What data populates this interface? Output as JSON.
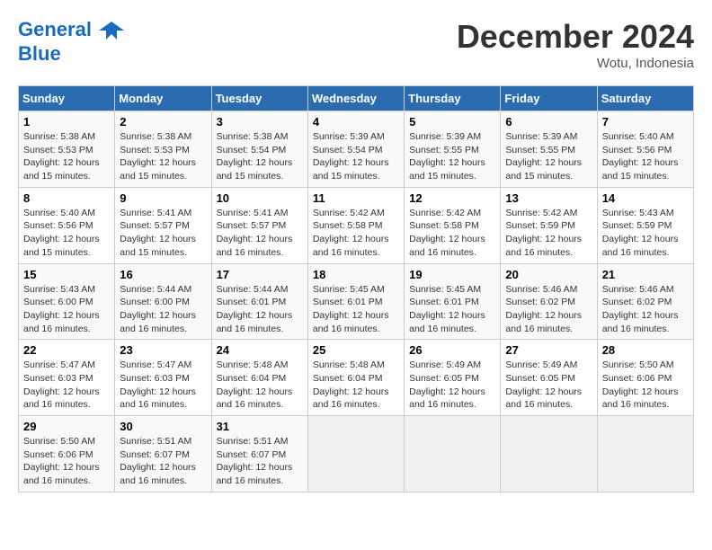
{
  "header": {
    "logo_line1": "General",
    "logo_line2": "Blue",
    "month": "December 2024",
    "location": "Wotu, Indonesia"
  },
  "days_of_week": [
    "Sunday",
    "Monday",
    "Tuesday",
    "Wednesday",
    "Thursday",
    "Friday",
    "Saturday"
  ],
  "weeks": [
    [
      {
        "day": "1",
        "sunrise": "5:38 AM",
        "sunset": "5:53 PM",
        "daylight": "12 hours and 15 minutes."
      },
      {
        "day": "2",
        "sunrise": "5:38 AM",
        "sunset": "5:53 PM",
        "daylight": "12 hours and 15 minutes."
      },
      {
        "day": "3",
        "sunrise": "5:38 AM",
        "sunset": "5:54 PM",
        "daylight": "12 hours and 15 minutes."
      },
      {
        "day": "4",
        "sunrise": "5:39 AM",
        "sunset": "5:54 PM",
        "daylight": "12 hours and 15 minutes."
      },
      {
        "day": "5",
        "sunrise": "5:39 AM",
        "sunset": "5:55 PM",
        "daylight": "12 hours and 15 minutes."
      },
      {
        "day": "6",
        "sunrise": "5:39 AM",
        "sunset": "5:55 PM",
        "daylight": "12 hours and 15 minutes."
      },
      {
        "day": "7",
        "sunrise": "5:40 AM",
        "sunset": "5:56 PM",
        "daylight": "12 hours and 15 minutes."
      }
    ],
    [
      {
        "day": "8",
        "sunrise": "5:40 AM",
        "sunset": "5:56 PM",
        "daylight": "12 hours and 15 minutes."
      },
      {
        "day": "9",
        "sunrise": "5:41 AM",
        "sunset": "5:57 PM",
        "daylight": "12 hours and 15 minutes."
      },
      {
        "day": "10",
        "sunrise": "5:41 AM",
        "sunset": "5:57 PM",
        "daylight": "12 hours and 16 minutes."
      },
      {
        "day": "11",
        "sunrise": "5:42 AM",
        "sunset": "5:58 PM",
        "daylight": "12 hours and 16 minutes."
      },
      {
        "day": "12",
        "sunrise": "5:42 AM",
        "sunset": "5:58 PM",
        "daylight": "12 hours and 16 minutes."
      },
      {
        "day": "13",
        "sunrise": "5:42 AM",
        "sunset": "5:59 PM",
        "daylight": "12 hours and 16 minutes."
      },
      {
        "day": "14",
        "sunrise": "5:43 AM",
        "sunset": "5:59 PM",
        "daylight": "12 hours and 16 minutes."
      }
    ],
    [
      {
        "day": "15",
        "sunrise": "5:43 AM",
        "sunset": "6:00 PM",
        "daylight": "12 hours and 16 minutes."
      },
      {
        "day": "16",
        "sunrise": "5:44 AM",
        "sunset": "6:00 PM",
        "daylight": "12 hours and 16 minutes."
      },
      {
        "day": "17",
        "sunrise": "5:44 AM",
        "sunset": "6:01 PM",
        "daylight": "12 hours and 16 minutes."
      },
      {
        "day": "18",
        "sunrise": "5:45 AM",
        "sunset": "6:01 PM",
        "daylight": "12 hours and 16 minutes."
      },
      {
        "day": "19",
        "sunrise": "5:45 AM",
        "sunset": "6:01 PM",
        "daylight": "12 hours and 16 minutes."
      },
      {
        "day": "20",
        "sunrise": "5:46 AM",
        "sunset": "6:02 PM",
        "daylight": "12 hours and 16 minutes."
      },
      {
        "day": "21",
        "sunrise": "5:46 AM",
        "sunset": "6:02 PM",
        "daylight": "12 hours and 16 minutes."
      }
    ],
    [
      {
        "day": "22",
        "sunrise": "5:47 AM",
        "sunset": "6:03 PM",
        "daylight": "12 hours and 16 minutes."
      },
      {
        "day": "23",
        "sunrise": "5:47 AM",
        "sunset": "6:03 PM",
        "daylight": "12 hours and 16 minutes."
      },
      {
        "day": "24",
        "sunrise": "5:48 AM",
        "sunset": "6:04 PM",
        "daylight": "12 hours and 16 minutes."
      },
      {
        "day": "25",
        "sunrise": "5:48 AM",
        "sunset": "6:04 PM",
        "daylight": "12 hours and 16 minutes."
      },
      {
        "day": "26",
        "sunrise": "5:49 AM",
        "sunset": "6:05 PM",
        "daylight": "12 hours and 16 minutes."
      },
      {
        "day": "27",
        "sunrise": "5:49 AM",
        "sunset": "6:05 PM",
        "daylight": "12 hours and 16 minutes."
      },
      {
        "day": "28",
        "sunrise": "5:50 AM",
        "sunset": "6:06 PM",
        "daylight": "12 hours and 16 minutes."
      }
    ],
    [
      {
        "day": "29",
        "sunrise": "5:50 AM",
        "sunset": "6:06 PM",
        "daylight": "12 hours and 16 minutes."
      },
      {
        "day": "30",
        "sunrise": "5:51 AM",
        "sunset": "6:07 PM",
        "daylight": "12 hours and 16 minutes."
      },
      {
        "day": "31",
        "sunrise": "5:51 AM",
        "sunset": "6:07 PM",
        "daylight": "12 hours and 16 minutes."
      },
      null,
      null,
      null,
      null
    ]
  ],
  "labels": {
    "sunrise_prefix": "Sunrise: ",
    "sunset_prefix": "Sunset: ",
    "daylight_prefix": "Daylight: "
  }
}
